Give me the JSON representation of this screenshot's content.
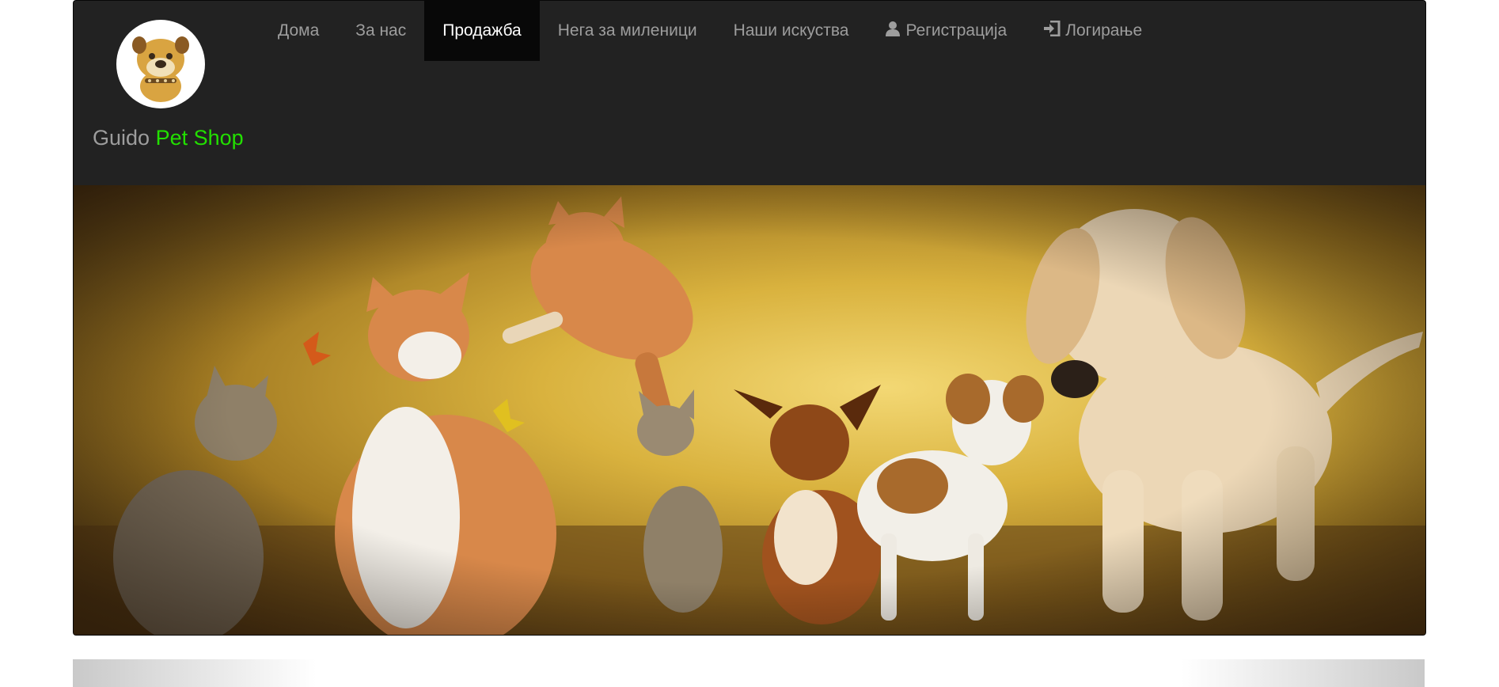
{
  "brand": {
    "name_part1": "Guido",
    "name_part2": "Pet Shop",
    "accent_color": "#22e000",
    "logo_icon": "bulldog-logo-icon"
  },
  "nav": {
    "items": [
      {
        "label": "Дома",
        "active": false
      },
      {
        "label": "За нас",
        "active": false
      },
      {
        "label": "Продажба",
        "active": true
      },
      {
        "label": "Нега за миленици",
        "active": false
      },
      {
        "label": "Наши искуства",
        "active": false
      },
      {
        "label": "Регистрација",
        "active": false,
        "icon": "user-icon"
      },
      {
        "label": "Логирање",
        "active": false,
        "icon": "login-icon"
      }
    ]
  },
  "hero": {
    "image": "pets-banner-image"
  },
  "colors": {
    "navbar_bg": "#222222",
    "active_bg": "#080808",
    "nav_text": "#9d9d9d",
    "active_text": "#ffffff"
  }
}
